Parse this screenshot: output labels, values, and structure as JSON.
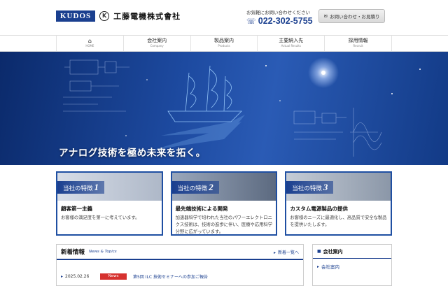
{
  "brand": {
    "logo_text": "KUDOS",
    "logo_mark": "K",
    "company_name": "工藤電機株式會社"
  },
  "contact": {
    "lead": "お気軽にお問い合わせください",
    "phone_icon": "phone-icon",
    "phone": "022-302-5755"
  },
  "inquiry_button": {
    "label": "お問い合わせ・お見積り",
    "icon": "mail-icon"
  },
  "nav": {
    "items": [
      {
        "label": "",
        "sub": "HOME",
        "icon": "home-icon"
      },
      {
        "label": "会社案内",
        "sub": "Company"
      },
      {
        "label": "製品案内",
        "sub": "Products"
      },
      {
        "label": "主要納入先",
        "sub": "Actual Results"
      },
      {
        "label": "採用情報",
        "sub": "Recruit"
      }
    ]
  },
  "hero": {
    "catchcopy": "アナログ技術を極め未来を拓く。"
  },
  "features": [
    {
      "label": "当社の特徴",
      "num": "1",
      "title": "顧客第一主義",
      "text": "お客様の満足度を第一に考えています。"
    },
    {
      "label": "当社の特徴",
      "num": "2",
      "title": "最先端技術による開発",
      "text": "加速器科学で培われた当社のパワーエレクトロニクス技術は、技術の進歩に伴い、医療や応用科学分野に広がっています。"
    },
    {
      "label": "当社の特徴",
      "num": "3",
      "title": "カスタム電源製品の提供",
      "text": "お客様のニーズに最適化し、高品質で安全な製品を提供いたします。"
    }
  ],
  "news": {
    "title": "新着情報",
    "subtitle": "News & Topics",
    "more": "新着一覧へ",
    "items": [
      {
        "date": "2025.02.26",
        "badge": "News",
        "text": "第5回 ILC 技術セミナーへの参加ご報告"
      }
    ]
  },
  "sidebar": {
    "title": "会社案内",
    "items": [
      "会社案内"
    ]
  },
  "colors": {
    "brand": "#1a3f8f",
    "badge": "#d6322f"
  }
}
